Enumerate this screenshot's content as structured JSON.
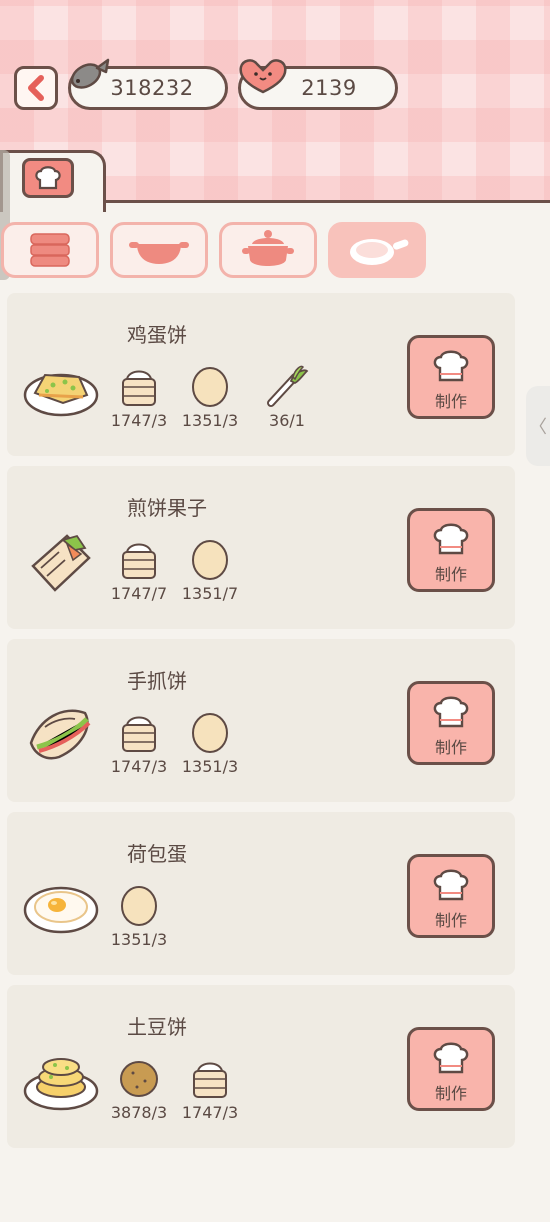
{
  "header": {
    "fish_count": "318232",
    "heart_count": "2139"
  },
  "tabs": {
    "main_tab_icon": "chef-hat-icon",
    "categories": [
      {
        "icon": "steamer-icon",
        "active": false
      },
      {
        "icon": "wok-icon",
        "active": false
      },
      {
        "icon": "pot-icon",
        "active": false
      },
      {
        "icon": "frying-pan-icon",
        "active": true
      }
    ]
  },
  "recipes": [
    {
      "name": "鸡蛋饼",
      "dish_icon": "egg-pancake-icon",
      "ingredients": [
        {
          "icon": "flour-icon",
          "count": "1747/3"
        },
        {
          "icon": "egg-icon",
          "count": "1351/3"
        },
        {
          "icon": "scallion-icon",
          "count": "36/1"
        }
      ],
      "button": "制作"
    },
    {
      "name": "煎饼果子",
      "dish_icon": "jianbing-icon",
      "ingredients": [
        {
          "icon": "flour-icon",
          "count": "1747/7"
        },
        {
          "icon": "egg-icon",
          "count": "1351/7"
        }
      ],
      "button": "制作"
    },
    {
      "name": "手抓饼",
      "dish_icon": "hand-pancake-icon",
      "ingredients": [
        {
          "icon": "flour-icon",
          "count": "1747/3"
        },
        {
          "icon": "egg-icon",
          "count": "1351/3"
        }
      ],
      "button": "制作"
    },
    {
      "name": "荷包蛋",
      "dish_icon": "fried-egg-icon",
      "ingredients": [
        {
          "icon": "egg-icon",
          "count": "1351/3"
        }
      ],
      "button": "制作"
    },
    {
      "name": "土豆饼",
      "dish_icon": "potato-pancake-icon",
      "ingredients": [
        {
          "icon": "potato-icon",
          "count": "3878/3"
        },
        {
          "icon": "flour-icon",
          "count": "1747/3"
        }
      ],
      "button": "制作"
    }
  ],
  "side_handle": "〈"
}
